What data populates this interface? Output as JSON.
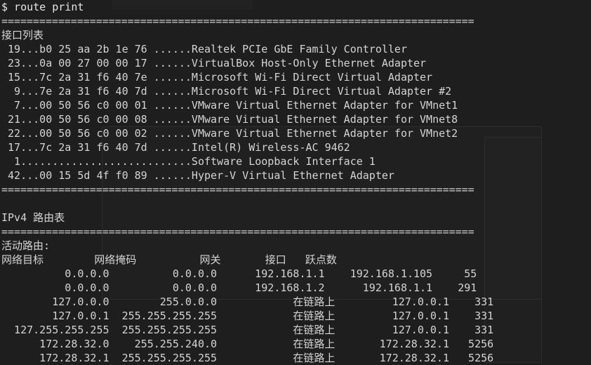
{
  "terminal": {
    "prompt": "$ route print",
    "divider": "===========================================================================",
    "interface_list": {
      "title": "接口列表",
      "rows": [
        " 19...b0 25 aa 2b 1e 76 ......Realtek PCIe GbE Family Controller",
        " 23...0a 00 27 00 00 17 ......VirtualBox Host-Only Ethernet Adapter",
        " 15...7c 2a 31 f6 40 7e ......Microsoft Wi-Fi Direct Virtual Adapter",
        "  9...7e 2a 31 f6 40 7d ......Microsoft Wi-Fi Direct Virtual Adapter #2",
        "  7...00 50 56 c0 00 01 ......VMware Virtual Ethernet Adapter for VMnet1",
        " 21...00 50 56 c0 00 08 ......VMware Virtual Ethernet Adapter for VMnet8",
        " 22...00 50 56 c0 00 02 ......VMware Virtual Ethernet Adapter for VMnet2",
        " 17...7c 2a 31 f6 40 7d ......Intel(R) Wireless-AC 9462",
        "  1...........................Software Loopback Interface 1",
        " 42...00 15 5d 4f f0 89 ......Hyper-V Virtual Ethernet Adapter"
      ]
    },
    "ipv4": {
      "title": "IPv4 路由表",
      "active_routes_label": "活动路由:",
      "header": "网络目标        网络掩码          网关       接口   跃点数",
      "rows": [
        "          0.0.0.0          0.0.0.0      192.168.1.1    192.168.1.105     55",
        "          0.0.0.0          0.0.0.0      192.168.1.2      192.168.1.1    291",
        "        127.0.0.0        255.0.0.0            在链路上         127.0.0.1    331",
        "        127.0.0.1  255.255.255.255            在链路上         127.0.0.1    331",
        "  127.255.255.255  255.255.255.255            在链路上         127.0.0.1    331",
        "      172.28.32.0    255.255.240.0            在链路上       172.28.32.1   5256",
        "      172.28.32.1  255.255.255.255            在链路上       172.28.32.1   5256"
      ]
    }
  }
}
